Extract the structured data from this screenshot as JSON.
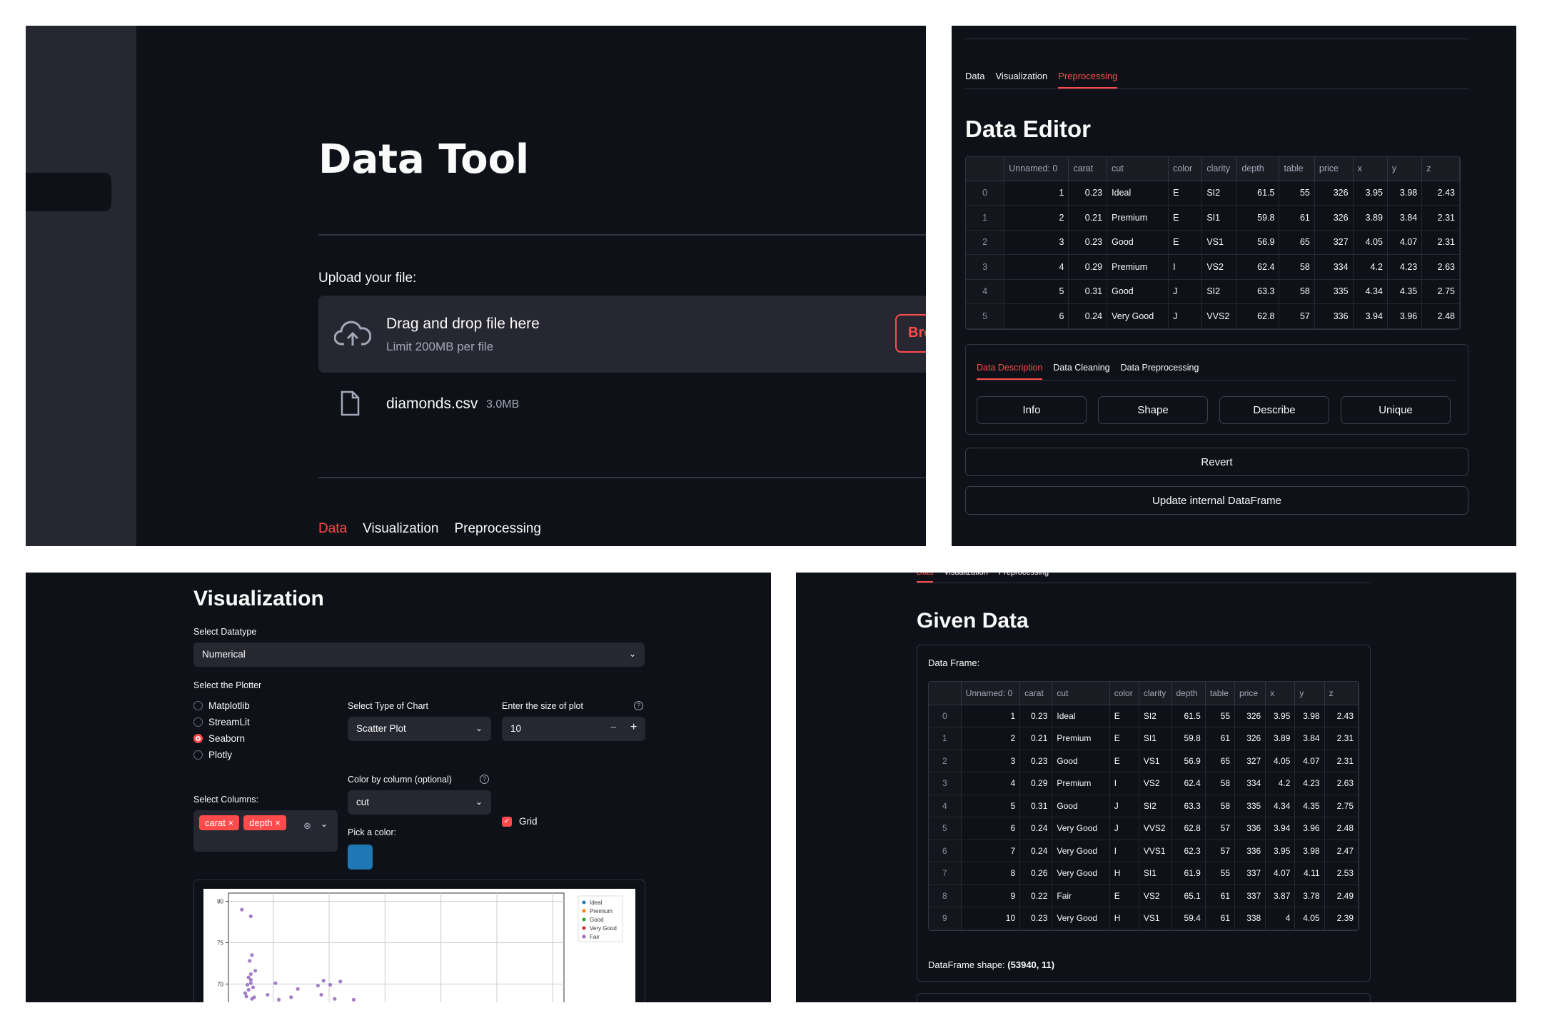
{
  "panel1": {
    "title": "Data Tool",
    "upload_label": "Upload your file:",
    "drop_title": "Drag and drop file here",
    "drop_limit": "Limit 200MB per file",
    "browse_label": "Bro",
    "file_name": "diamonds.csv",
    "file_size": "3.0MB",
    "tabs": [
      "Data",
      "Visualization",
      "Preprocessing"
    ],
    "active_tab": "Data"
  },
  "panel2": {
    "tabs": [
      "Data",
      "Visualization",
      "Preprocessing"
    ],
    "active_tab": "Preprocessing",
    "title": "Data Editor",
    "columns": [
      "",
      "Unnamed: 0",
      "carat",
      "cut",
      "color",
      "clarity",
      "depth",
      "table",
      "price",
      "x",
      "y",
      "z"
    ],
    "rows": [
      [
        "0",
        "1",
        "0.23",
        "Ideal",
        "E",
        "SI2",
        "61.5",
        "55",
        "326",
        "3.95",
        "3.98",
        "2.43"
      ],
      [
        "1",
        "2",
        "0.21",
        "Premium",
        "E",
        "SI1",
        "59.8",
        "61",
        "326",
        "3.89",
        "3.84",
        "2.31"
      ],
      [
        "2",
        "3",
        "0.23",
        "Good",
        "E",
        "VS1",
        "56.9",
        "65",
        "327",
        "4.05",
        "4.07",
        "2.31"
      ],
      [
        "3",
        "4",
        "0.29",
        "Premium",
        "I",
        "VS2",
        "62.4",
        "58",
        "334",
        "4.2",
        "4.23",
        "2.63"
      ],
      [
        "4",
        "5",
        "0.31",
        "Good",
        "J",
        "SI2",
        "63.3",
        "58",
        "335",
        "4.34",
        "4.35",
        "2.75"
      ],
      [
        "5",
        "6",
        "0.24",
        "Very Good",
        "J",
        "VVS2",
        "62.8",
        "57",
        "336",
        "3.94",
        "3.96",
        "2.48"
      ]
    ],
    "subtabs": [
      "Data Description",
      "Data Cleaning",
      "Data Preprocessing"
    ],
    "active_subtab": "Data Description",
    "buttons": {
      "info": "Info",
      "shape": "Shape",
      "describe": "Describe",
      "unique": "Unique"
    },
    "revert": "Revert",
    "update": "Update internal DataFrame"
  },
  "panel3": {
    "title": "Visualization",
    "datatype_label": "Select Datatype",
    "datatype_value": "Numerical",
    "plotter_label": "Select the Plotter",
    "plotters": [
      "Matplotlib",
      "StreamLit",
      "Seaborn",
      "Plotly"
    ],
    "selected_plotter": "Seaborn",
    "chart_type_label": "Select Type of Chart",
    "chart_type_value": "Scatter Plot",
    "size_label": "Enter the size of plot",
    "size_value": "10",
    "columns_label": "Select Columns:",
    "columns_selected": [
      "carat",
      "depth"
    ],
    "color_by_label": "Color by column (optional)",
    "color_by_value": "cut",
    "grid_label": "Grid",
    "grid_checked": true,
    "pick_color_label": "Pick a color:",
    "picked_color": "#1f77b4",
    "icons": [
      "chevron-down-icon",
      "help-icon",
      "close-icon",
      "clear-icon",
      "minus-icon",
      "plus-icon"
    ]
  },
  "chart_data": {
    "type": "scatter",
    "title": "",
    "xlabel": "",
    "ylabel": "",
    "y_ticks": [
      "80",
      "75",
      "70"
    ],
    "legend": [
      "Ideal",
      "Premium",
      "Good",
      "Very Good",
      "Fair"
    ],
    "legend_colors": [
      "#1f77b4",
      "#ff7f0e",
      "#2ca02c",
      "#d62728",
      "#9467bd"
    ],
    "legend_position": "top-right",
    "grid": true,
    "series": [
      {
        "name": "Fair",
        "x": [
          0.22,
          0.3,
          0.26,
          0.28,
          0.3,
          0.31,
          0.32,
          0.25,
          0.33,
          0.28,
          0.3,
          0.29,
          0.34,
          0.31,
          0.45,
          0.52,
          0.55,
          0.66,
          0.72,
          0.9,
          0.93,
          0.95,
          1.01,
          1.05,
          1.1,
          1.22,
          0.27,
          0.3
        ],
        "y": [
          79,
          78.2,
          68.5,
          69.3,
          70.1,
          68.2,
          69.6,
          68.9,
          68.4,
          70.8,
          71.2,
          72.8,
          71.6,
          73.5,
          68.7,
          70.1,
          68.1,
          68.4,
          69.4,
          69.8,
          68.7,
          70.4,
          69.9,
          68.2,
          70.3,
          68.1,
          69.9,
          70.5
        ]
      }
    ]
  },
  "panel4": {
    "tabs_cut": [
      "Data",
      "Visualization",
      "Preprocessing"
    ],
    "title": "Given Data",
    "frame_label": "Data Frame:",
    "columns": [
      "",
      "Unnamed: 0",
      "carat",
      "cut",
      "color",
      "clarity",
      "depth",
      "table",
      "price",
      "x",
      "y",
      "z"
    ],
    "rows": [
      [
        "0",
        "1",
        "0.23",
        "Ideal",
        "E",
        "SI2",
        "61.5",
        "55",
        "326",
        "3.95",
        "3.98",
        "2.43"
      ],
      [
        "1",
        "2",
        "0.21",
        "Premium",
        "E",
        "SI1",
        "59.8",
        "61",
        "326",
        "3.89",
        "3.84",
        "2.31"
      ],
      [
        "2",
        "3",
        "0.23",
        "Good",
        "E",
        "VS1",
        "56.9",
        "65",
        "327",
        "4.05",
        "4.07",
        "2.31"
      ],
      [
        "3",
        "4",
        "0.29",
        "Premium",
        "I",
        "VS2",
        "62.4",
        "58",
        "334",
        "4.2",
        "4.23",
        "2.63"
      ],
      [
        "4",
        "5",
        "0.31",
        "Good",
        "J",
        "SI2",
        "63.3",
        "58",
        "335",
        "4.34",
        "4.35",
        "2.75"
      ],
      [
        "5",
        "6",
        "0.24",
        "Very Good",
        "J",
        "VVS2",
        "62.8",
        "57",
        "336",
        "3.94",
        "3.96",
        "2.48"
      ],
      [
        "6",
        "7",
        "0.24",
        "Very Good",
        "I",
        "VVS1",
        "62.3",
        "57",
        "336",
        "3.95",
        "3.98",
        "2.47"
      ],
      [
        "7",
        "8",
        "0.26",
        "Very Good",
        "H",
        "SI1",
        "61.9",
        "55",
        "337",
        "4.07",
        "4.11",
        "2.53"
      ],
      [
        "8",
        "9",
        "0.22",
        "Fair",
        "E",
        "VS2",
        "65.1",
        "61",
        "337",
        "3.87",
        "3.78",
        "2.49"
      ],
      [
        "9",
        "10",
        "0.23",
        "Very Good",
        "H",
        "VS1",
        "59.4",
        "61",
        "338",
        "4",
        "4.05",
        "2.39"
      ]
    ],
    "shape_label": "DataFrame shape:",
    "shape_value": "(53940, 11)"
  },
  "colors": {
    "background": "#0e1117",
    "widget": "#262730",
    "accent": "#ff4b4b",
    "border": "#31333f"
  }
}
